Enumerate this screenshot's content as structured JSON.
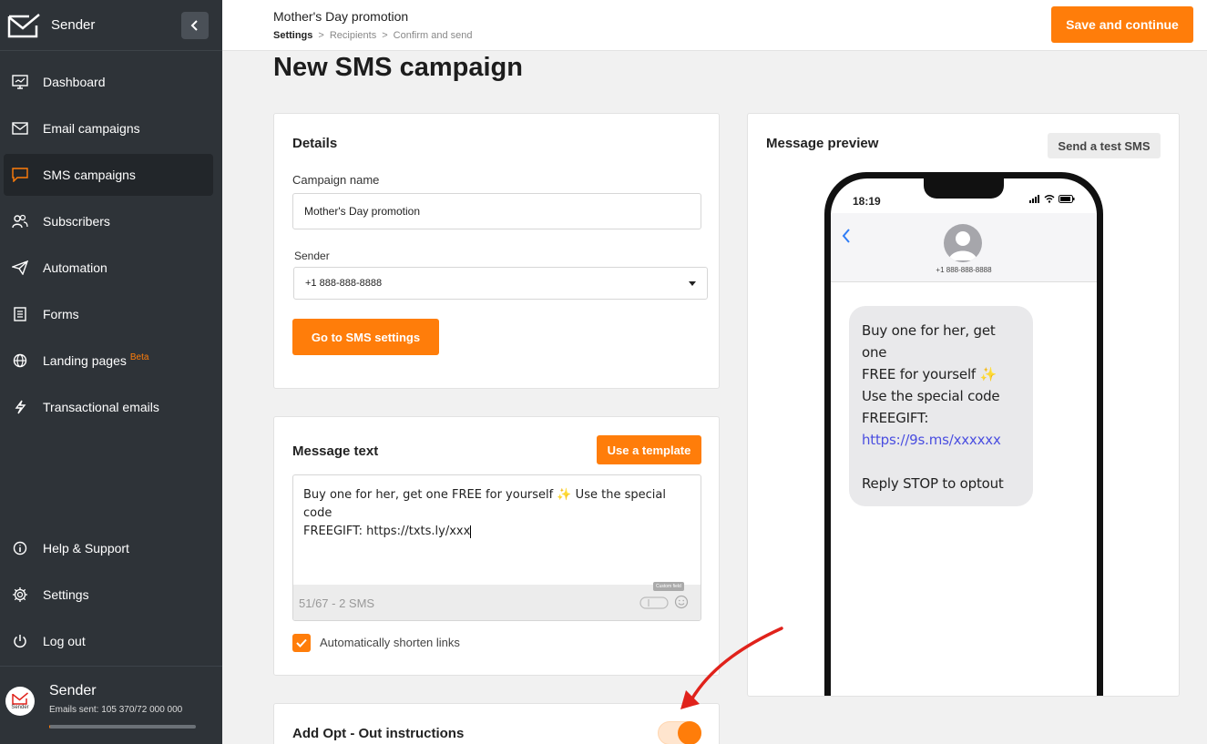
{
  "sidebar": {
    "brand": "Sender",
    "items": [
      {
        "label": "Dashboard",
        "icon": "dashboard-icon"
      },
      {
        "label": "Email campaigns",
        "icon": "envelope-icon"
      },
      {
        "label": "SMS campaigns",
        "icon": "chat-bubble-icon",
        "active": true
      },
      {
        "label": "Subscribers",
        "icon": "users-icon"
      },
      {
        "label": "Automation",
        "icon": "paper-plane-icon"
      },
      {
        "label": "Forms",
        "icon": "form-icon"
      },
      {
        "label": "Landing pages",
        "icon": "globe-icon",
        "badge": "Beta"
      },
      {
        "label": "Transactional emails",
        "icon": "lightning-icon"
      }
    ],
    "bottom_items": [
      {
        "label": "Help & Support",
        "icon": "info-icon"
      },
      {
        "label": "Settings",
        "icon": "gear-icon"
      },
      {
        "label": "Log out",
        "icon": "power-icon"
      }
    ],
    "user": {
      "name": "Sender",
      "emails_sent": "Emails sent: 105 370/72 000 000",
      "avatar_text": "Sender",
      "usage_fraction": 0.0015
    }
  },
  "header": {
    "campaign_title": "Mother's Day promotion",
    "breadcrumb": [
      "Settings",
      "Recipients",
      "Confirm and send"
    ],
    "save_label": "Save and continue"
  },
  "page_title": "New SMS campaign",
  "details": {
    "title": "Details",
    "campaign_name_label": "Campaign name",
    "campaign_name_value": "Mother's Day promotion",
    "sender_label": "Sender",
    "sender_value": "+1 888-888-8888",
    "sms_settings_button": "Go to SMS settings"
  },
  "message": {
    "title": "Message text",
    "template_button": "Use a template",
    "text_line1": "Buy one for her, get one FREE for yourself ✨ Use the special code",
    "text_line2": "FREEGIFT: https://txts.ly/xxx",
    "char_count": "51/67 - 2 SMS",
    "custom_field_tooltip": "Custom field",
    "shorten_links_label": "Automatically shorten links",
    "shorten_links_checked": true
  },
  "optout": {
    "title": "Add Opt - Out instructions",
    "enabled": true
  },
  "preview": {
    "title": "Message preview",
    "test_button": "Send a test SMS",
    "time": "18:19",
    "contact_number": "+1 888-888-8888",
    "bubble_line1": "Buy one for her, get one",
    "bubble_line2": "FREE for yourself ✨",
    "bubble_line3": "Use the special code",
    "bubble_line4": "FREEGIFT:",
    "bubble_link": "https://9s.ms/xxxxxx",
    "bubble_optout": "Reply STOP to optout"
  },
  "colors": {
    "accent": "#ff7d0a",
    "sidebar_bg": "#2e3338",
    "sidebar_active": "#22262a",
    "annotation_arrow": "#e0221b",
    "link": "#4a4ee0"
  }
}
